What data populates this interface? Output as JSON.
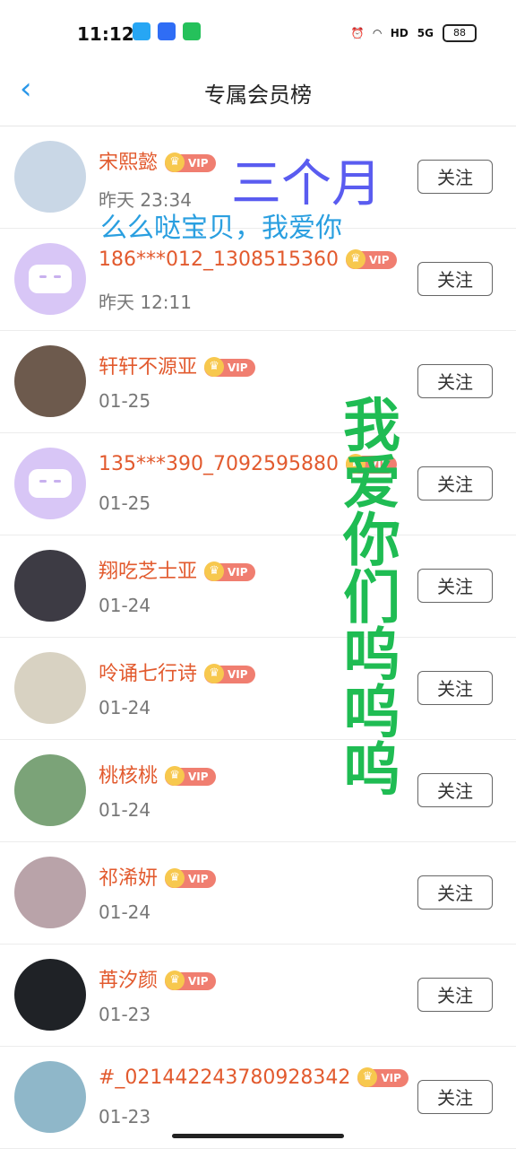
{
  "status_bar": {
    "time": "11:12",
    "network_label": "HD",
    "signal_label": "5G",
    "battery": "88"
  },
  "header": {
    "back_icon": "chevron-left-icon",
    "title": "专属会员榜"
  },
  "follow_label": "关注",
  "vip_label": "VIP",
  "members": [
    {
      "name": "宋熙懿",
      "date": "昨天 23:34",
      "avatar": "photo",
      "avatar_color": "#c9d7e6"
    },
    {
      "name": "186***012_1308515360",
      "date": "昨天 12:11",
      "avatar": "placeholder",
      "avatar_color": "#d8c6f6"
    },
    {
      "name": "轩轩不源亚",
      "date": "01-25",
      "avatar": "photo",
      "avatar_color": "#6d5a4d"
    },
    {
      "name": "135***390_7092595880",
      "date": "01-25",
      "avatar": "placeholder",
      "avatar_color": "#d8c6f6"
    },
    {
      "name": "翔吃芝士亚",
      "date": "01-24",
      "avatar": "photo",
      "avatar_color": "#3d3b44"
    },
    {
      "name": "呤诵七行诗",
      "date": "01-24",
      "avatar": "photo",
      "avatar_color": "#d8d2c2"
    },
    {
      "name": "桃核桃",
      "date": "01-24",
      "avatar": "photo",
      "avatar_color": "#7ba378"
    },
    {
      "name": "祁浠妍",
      "date": "01-24",
      "avatar": "photo",
      "avatar_color": "#b9a3a9"
    },
    {
      "name": "苒汐颜",
      "date": "01-23",
      "avatar": "photo",
      "avatar_color": "#1f2226"
    },
    {
      "name": "#_021442243780928342",
      "date": "01-23",
      "avatar": "photo",
      "avatar_color": "#8fb7c9"
    }
  ],
  "overlay_text": {
    "purple": "三个月",
    "blue": "么么哒宝贝，我爱你",
    "green": "我爱你们呜呜呜"
  },
  "colors": {
    "accent": "#2a97e8",
    "name": "#e25a2e",
    "vip_badge": "#f07e70",
    "overlay_purple": "#5a5cf0",
    "overlay_blue": "#2a9fe0",
    "overlay_green": "#1fbc53"
  }
}
